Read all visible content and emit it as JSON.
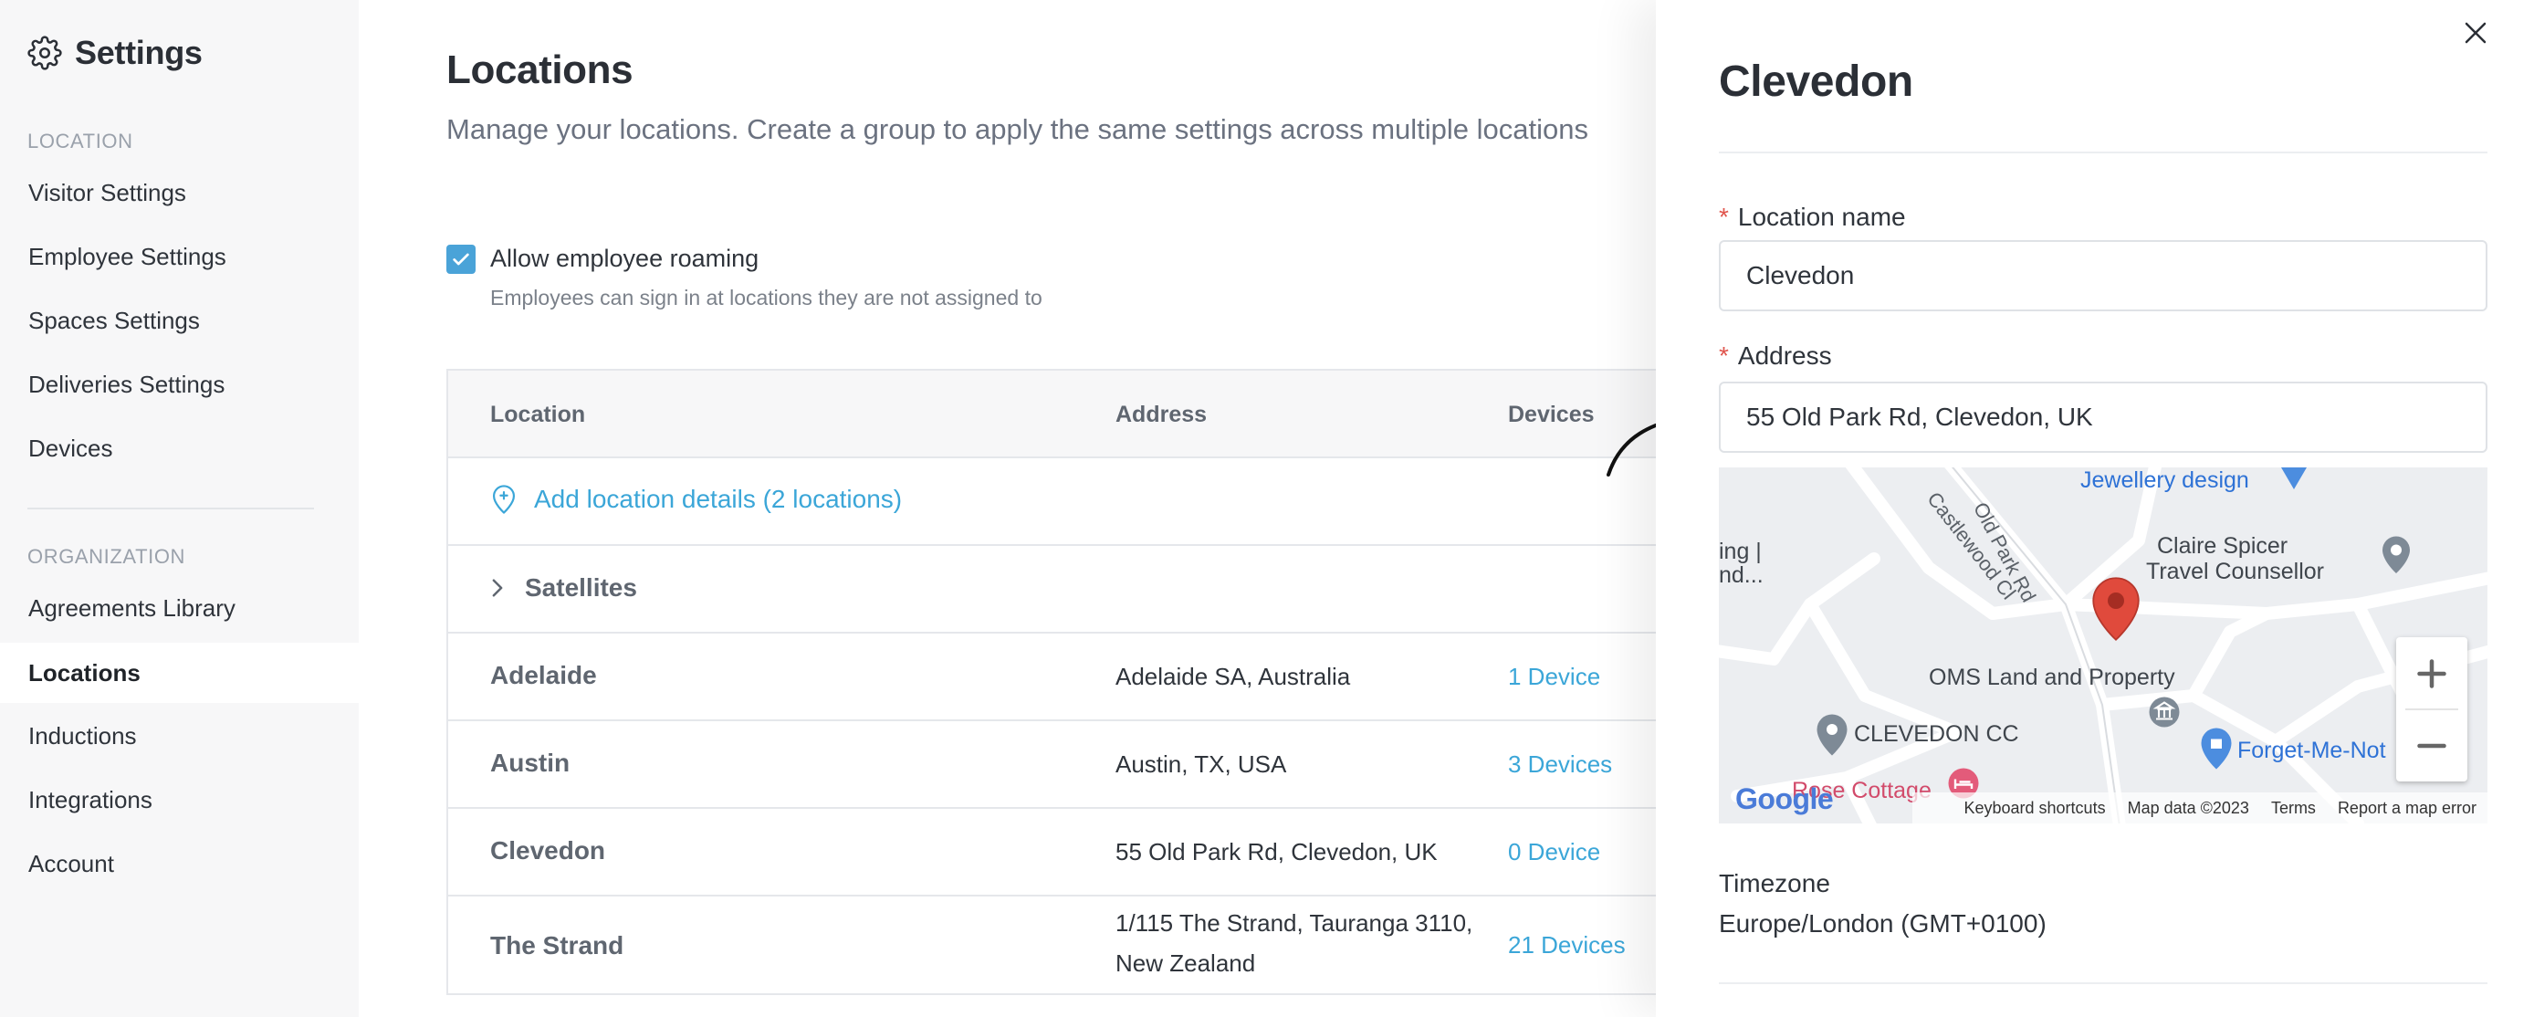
{
  "sidebar": {
    "title": "Settings",
    "sections": [
      {
        "label": "LOCATION"
      },
      {
        "label": "ORGANIZATION"
      }
    ],
    "items": [
      {
        "label": "Visitor Settings"
      },
      {
        "label": "Employee Settings"
      },
      {
        "label": "Spaces Settings"
      },
      {
        "label": "Deliveries Settings"
      },
      {
        "label": "Devices"
      },
      {
        "label": "Agreements Library"
      },
      {
        "label": "Locations"
      },
      {
        "label": "Inductions"
      },
      {
        "label": "Integrations"
      },
      {
        "label": "Account"
      }
    ]
  },
  "main": {
    "title": "Locations",
    "subtitle": "Manage your locations. Create a group to apply the same settings across multiple locations",
    "roaming": {
      "label": "Allow employee roaming",
      "help": "Employees can sign in at locations they are not assigned to",
      "checked": true
    },
    "table": {
      "headers": {
        "location": "Location",
        "address": "Address",
        "devices": "Devices"
      },
      "add_details": "Add location details (2 locations)",
      "group": "Satellites",
      "rows": [
        {
          "name": "Adelaide",
          "address": "Adelaide SA, Australia",
          "address2": "",
          "devices": "1 Device"
        },
        {
          "name": "Austin",
          "address": "Austin, TX, USA",
          "address2": "",
          "devices": "3 Devices"
        },
        {
          "name": "Clevedon",
          "address": "55 Old Park Rd, Clevedon, UK",
          "address2": "",
          "devices": "0 Device"
        },
        {
          "name": "The Strand",
          "address": "1/115 The Strand, Tauranga 3110,",
          "address2": "New Zealand",
          "devices": "21 Devices"
        }
      ]
    }
  },
  "panel": {
    "title": "Clevedon",
    "location_name": {
      "label": "Location name",
      "value": "Clevedon"
    },
    "address": {
      "label": "Address",
      "value": "55 Old Park Rd, Clevedon, UK"
    },
    "map": {
      "pois": {
        "jewellery": "Jewellery design",
        "old_park": "Old Park Rd",
        "castlewood": "Castlewood Cl",
        "claire1": "Claire Spicer",
        "claire2": "Travel Counsellor",
        "ing1": "ing |",
        "ing2": "nd...",
        "oms": "OMS Land and Property",
        "cc": "CLEVEDON CC",
        "forget": "Forget-Me-Not",
        "rose": "Rose Cottage"
      },
      "logo": "Google",
      "footer": {
        "shortcuts": "Keyboard shortcuts",
        "data": "Map data ©2023",
        "terms": "Terms",
        "report": "Report a map error"
      }
    },
    "timezone": {
      "label": "Timezone",
      "value": "Europe/London (GMT+0100)"
    }
  },
  "colors": {
    "accent": "#3ba6d8",
    "required": "#e0554d",
    "pin": "#e04a3c"
  }
}
